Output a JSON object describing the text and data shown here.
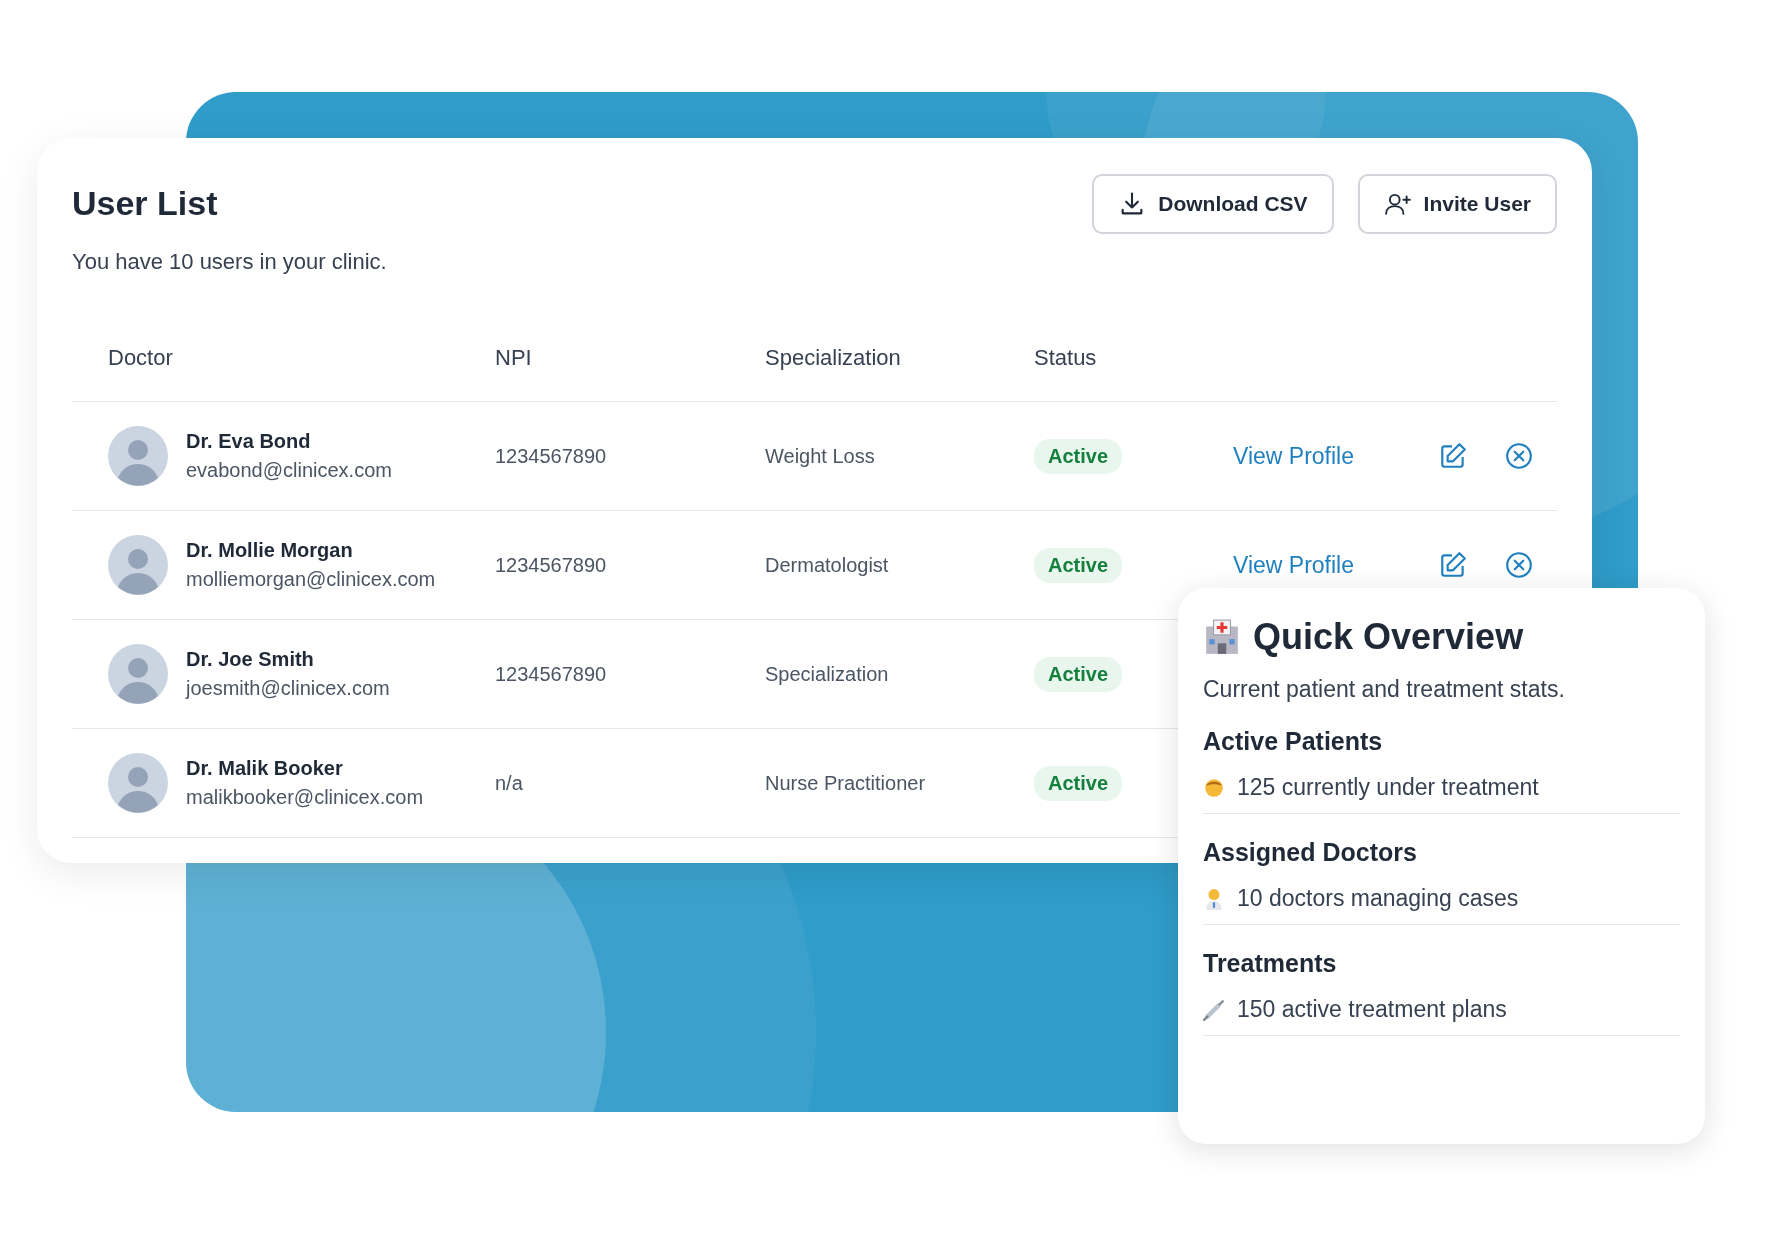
{
  "user_list": {
    "title": "User List",
    "subtitle": "You have 10 users in your clinic.",
    "buttons": [
      {
        "kind": "download",
        "label": "Download CSV"
      },
      {
        "kind": "invite",
        "label": "Invite User"
      }
    ],
    "columns": [
      "Doctor",
      "NPI",
      "Specialization",
      "Status"
    ],
    "rows": [
      {
        "name": "Dr. Eva Bond",
        "email": "evabond@clinicex.com",
        "npi": "1234567890",
        "specialization": "Weight Loss",
        "status": "Active",
        "view_link": "View Profile"
      },
      {
        "name": "Dr. Mollie Morgan",
        "email": "molliemorgan@clinicex.com",
        "npi": "1234567890",
        "specialization": "Dermatologist",
        "status": "Active",
        "view_link": "View Profile"
      },
      {
        "name": "Dr. Joe Smith",
        "email": "joesmith@clinicex.com",
        "npi": "1234567890",
        "specialization": "Specialization",
        "status": "Active"
      },
      {
        "name": "Dr. Malik Booker",
        "email": "malikbooker@clinicex.com",
        "npi": "n/a",
        "specialization": "Nurse Practitioner",
        "status": "Active"
      }
    ]
  },
  "quick_overview": {
    "title": "Quick Overview",
    "subtitle": "Current patient and treatment stats.",
    "sections": [
      {
        "title": "Active Patients",
        "kind": "person",
        "text": "125 currently under treatment"
      },
      {
        "title": "Assigned Doctors",
        "kind": "doctor",
        "text": "10 doctors managing cases"
      },
      {
        "title": "Treatments",
        "kind": "syringe",
        "text": "150 active treatment plans"
      }
    ]
  }
}
